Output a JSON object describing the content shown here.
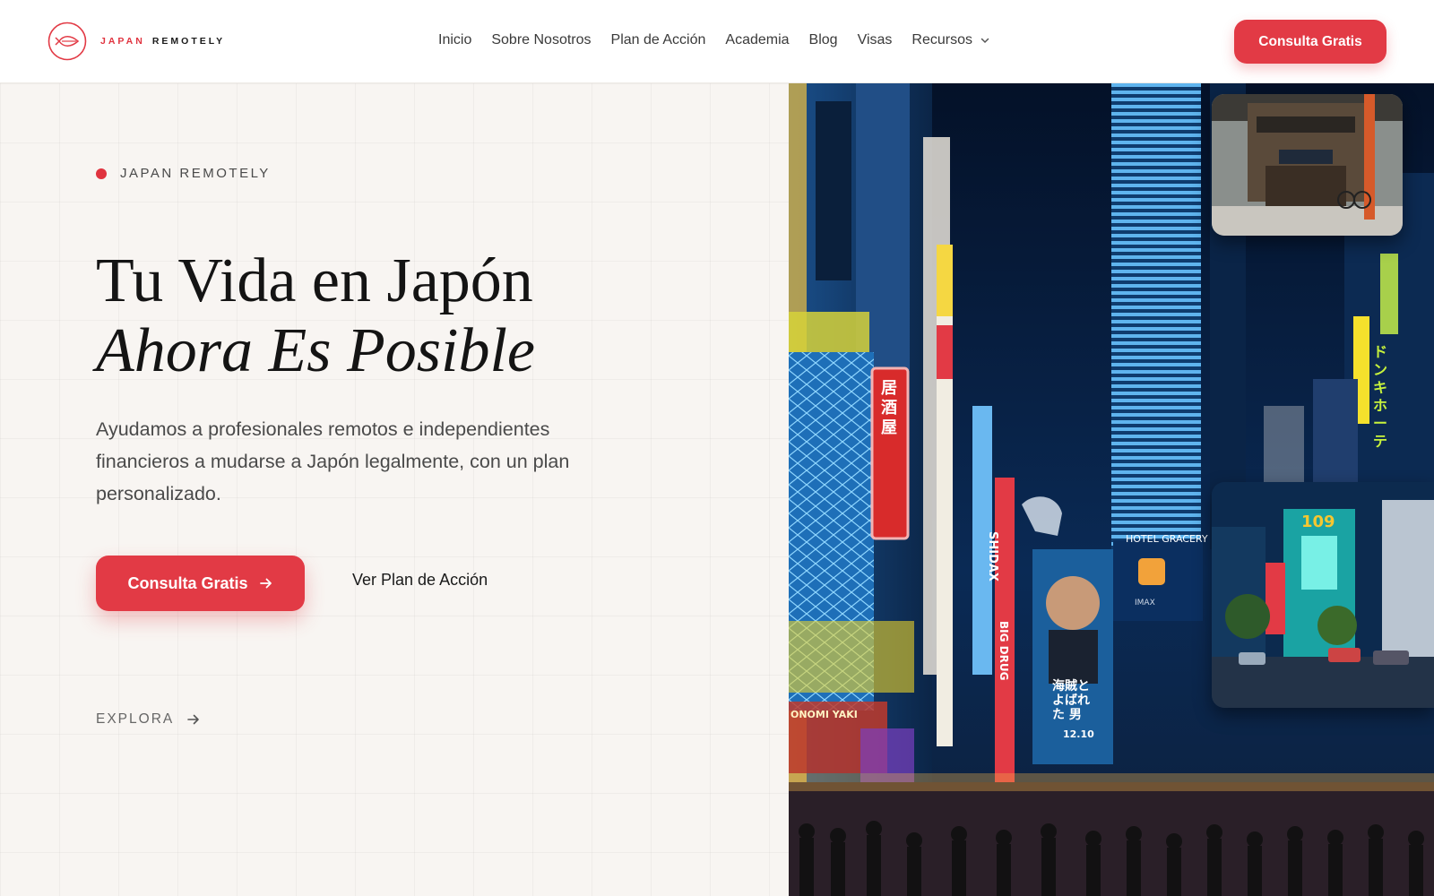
{
  "brand": {
    "word1": "JAPAN",
    "word2": "REMOTELY",
    "accent_color": "#e23a45",
    "logo_icon": "fish-circle-icon"
  },
  "nav": {
    "items": [
      {
        "label": "Inicio"
      },
      {
        "label": "Sobre Nosotros"
      },
      {
        "label": "Plan de Acción"
      },
      {
        "label": "Academia"
      },
      {
        "label": "Blog"
      },
      {
        "label": "Visas"
      },
      {
        "label": "Recursos",
        "icon": "chevron-down-icon"
      }
    ],
    "cta_label": "Consulta Gratis"
  },
  "hero": {
    "eyebrow": "JAPAN REMOTELY",
    "title_line1": "Tu Vida en Japón",
    "title_line2": "Ahora Es Posible",
    "description": "Ayudamos a profesionales remotos e independientes financieros a mudarse a Japón legalmente, con un plan personalizado.",
    "primary_cta": "Consulta Gratis",
    "secondary_cta": "Ver Plan de Acción",
    "explore_label": "EXPLORA"
  },
  "image": {
    "signs": {
      "hotel": "HOTEL GRACERY",
      "imax": "IMAX",
      "big_drug": "BIG DRUG",
      "shibuya": "SHIDAX",
      "date": "12.10",
      "store_109": "109",
      "onomi": "ONOMI YAKI",
      "vertical_1": "居酒屋",
      "vertical_2": "ドンキホーテ",
      "poster": "海賊と よばれた 男"
    }
  }
}
